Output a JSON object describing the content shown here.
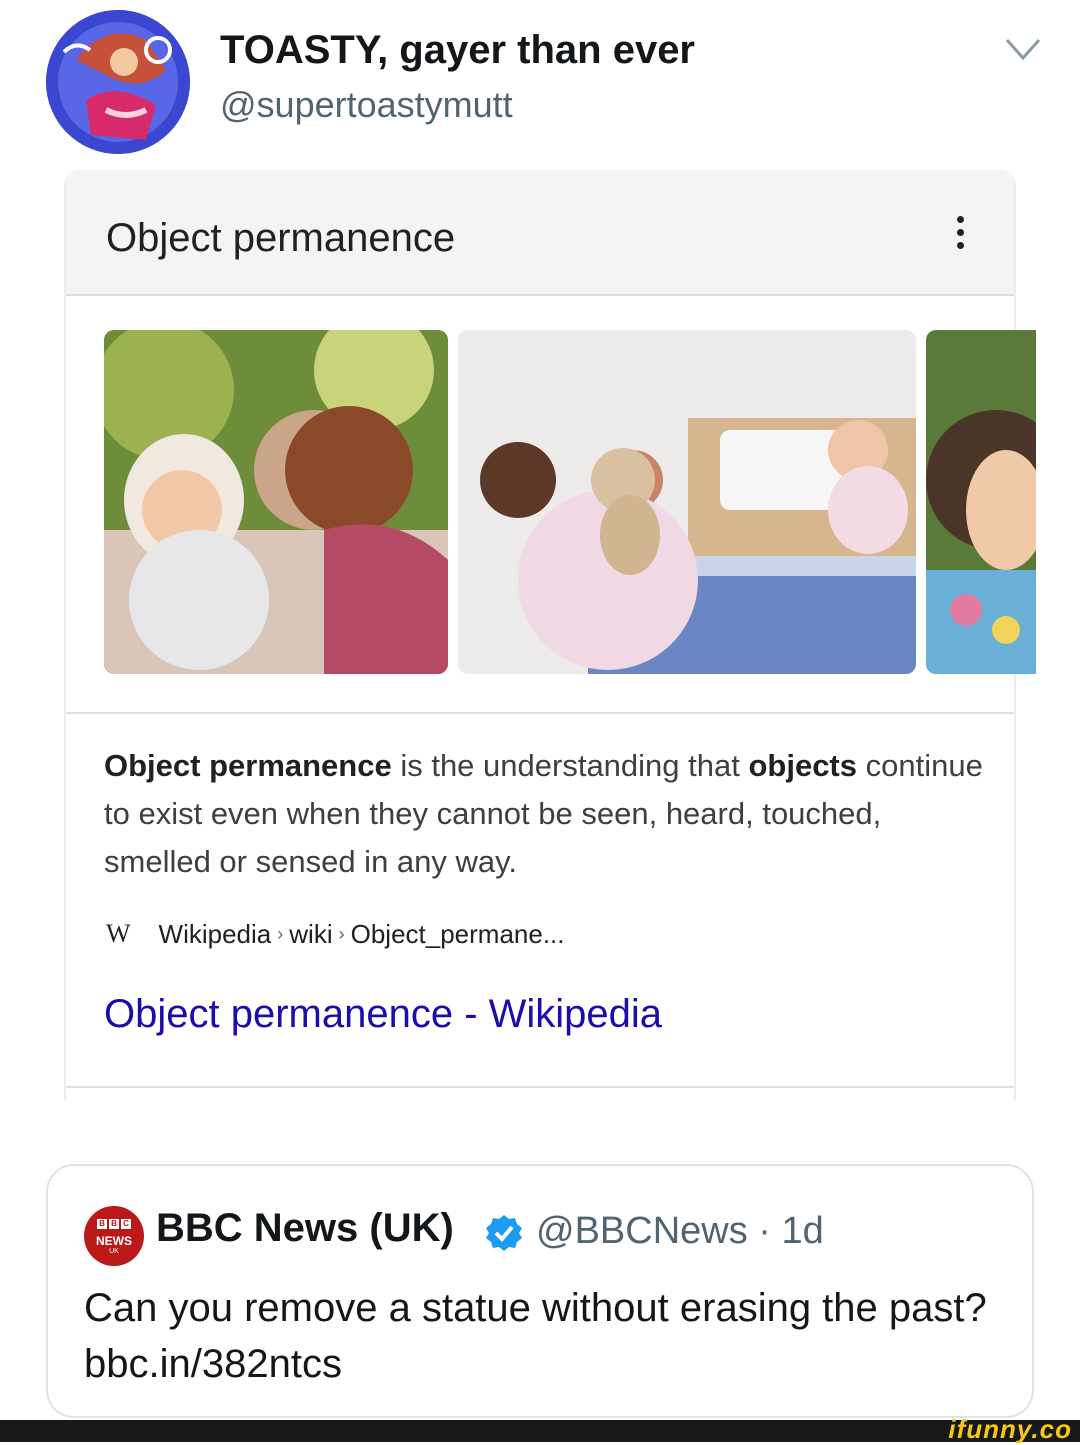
{
  "tweet": {
    "display_name": "TOASTY, gayer than ever",
    "handle": "@supertoastymutt"
  },
  "card": {
    "title": "Object permanence",
    "description": {
      "term": "Object permanence",
      "part1": " is the understanding that ",
      "bold2": "objects",
      "part2": " continue to exist even when they cannot be seen, heard, touched, smelled or sensed in any way."
    },
    "source": {
      "icon": "W",
      "crumbs": [
        "Wikipedia",
        "wiki",
        "Object_permane..."
      ]
    },
    "link_text": "Object permanence - Wikipedia",
    "images": [
      "mother-peekaboo-baby-photo",
      "woman-teddy-bear-baby-photo",
      "child-covering-face-photo"
    ]
  },
  "quote": {
    "name": "BBC News (UK)",
    "handle_time": "@BBCNews · 1d",
    "text": "Can you remove a statue without erasing the past? bbc.in/382ntcs",
    "logo": {
      "top": "BBC",
      "mid": "NEWS",
      "bottom": "UK"
    }
  },
  "watermark": "ifunny.co",
  "colors": {
    "link": "#1a0dab",
    "verified": "#1d9bf0",
    "bbc_red": "#bb1919",
    "ifunny_yellow": "#f6c715"
  }
}
